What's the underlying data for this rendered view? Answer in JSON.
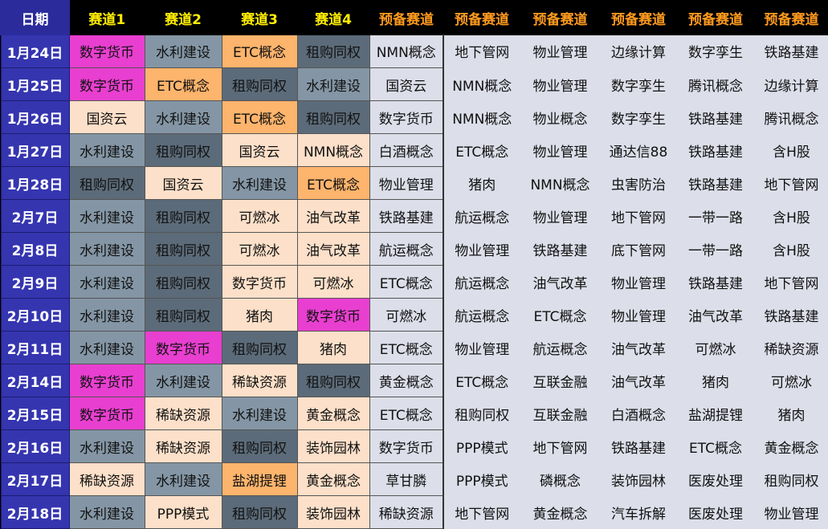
{
  "headers": [
    "日期",
    "赛道1",
    "赛道2",
    "赛道3",
    "赛道4",
    "预备赛道",
    "预备赛道",
    "预备赛道",
    "预备赛道",
    "预备赛道",
    "预备赛道"
  ],
  "colors": {
    "magenta": "#e83fd0",
    "steel": "#8496a5",
    "orange": "#fdb46c",
    "dark": "#5c6b79",
    "peach": "#fde0c9",
    "light": "#dcdee9"
  },
  "rows": [
    {
      "date": "1月24日",
      "lanes": [
        [
          "数字货币",
          "magenta"
        ],
        [
          "水利建设",
          "steel"
        ],
        [
          "ETC概念",
          "orange"
        ],
        [
          "租购同权",
          "dark"
        ],
        [
          "NMN概念",
          "light"
        ]
      ],
      "reserve": [
        "地下管网",
        "物业管理",
        "边缘计算",
        "数字孪生",
        "铁路基建"
      ]
    },
    {
      "date": "1月25日",
      "lanes": [
        [
          "数字货币",
          "magenta"
        ],
        [
          "ETC概念",
          "orange"
        ],
        [
          "租购同权",
          "dark"
        ],
        [
          "水利建设",
          "steel"
        ],
        [
          "国资云",
          "light"
        ]
      ],
      "reserve": [
        "NMN概念",
        "物业管理",
        "数字孪生",
        "腾讯概念",
        "边缘计算"
      ]
    },
    {
      "date": "1月26日",
      "lanes": [
        [
          "国资云",
          "peach"
        ],
        [
          "水利建设",
          "steel"
        ],
        [
          "ETC概念",
          "orange"
        ],
        [
          "租购同权",
          "dark"
        ],
        [
          "数字货币",
          "light"
        ]
      ],
      "reserve": [
        "NMN概念",
        "物业概念",
        "数字孪生",
        "铁路基建",
        "腾讯概念"
      ]
    },
    {
      "date": "1月27日",
      "lanes": [
        [
          "水利建设",
          "steel"
        ],
        [
          "租购同权",
          "dark"
        ],
        [
          "国资云",
          "peach"
        ],
        [
          "NMN概念",
          "peach"
        ],
        [
          "白酒概念",
          "light"
        ]
      ],
      "reserve": [
        "ETC概念",
        "物业管理",
        "通达信88",
        "铁路基建",
        "含H股"
      ]
    },
    {
      "date": "1月28日",
      "lanes": [
        [
          "租购同权",
          "dark"
        ],
        [
          "国资云",
          "peach"
        ],
        [
          "水利建设",
          "steel"
        ],
        [
          "ETC概念",
          "orange"
        ],
        [
          "物业管理",
          "light"
        ]
      ],
      "reserve": [
        "猪肉",
        "NMN概念",
        "虫害防治",
        "铁路基建",
        "地下管网"
      ]
    },
    {
      "date": "2月7日",
      "lanes": [
        [
          "水利建设",
          "steel"
        ],
        [
          "租购同权",
          "dark"
        ],
        [
          "可燃冰",
          "peach"
        ],
        [
          "油气改革",
          "peach"
        ],
        [
          "铁路基建",
          "light"
        ]
      ],
      "reserve": [
        "航运概念",
        "物业管理",
        "地下管网",
        "一带一路",
        "含H股"
      ]
    },
    {
      "date": "2月8日",
      "lanes": [
        [
          "水利建设",
          "steel"
        ],
        [
          "租购同权",
          "dark"
        ],
        [
          "可燃冰",
          "peach"
        ],
        [
          "油气改革",
          "peach"
        ],
        [
          "航运概念",
          "light"
        ]
      ],
      "reserve": [
        "物业管理",
        "铁路基建",
        "底下管网",
        "一带一路",
        "含H股"
      ]
    },
    {
      "date": "2月9日",
      "lanes": [
        [
          "水利建设",
          "steel"
        ],
        [
          "租购同权",
          "dark"
        ],
        [
          "数字货币",
          "peach"
        ],
        [
          "可燃冰",
          "peach"
        ],
        [
          "ETC概念",
          "light"
        ]
      ],
      "reserve": [
        "航运概念",
        "油气改革",
        "物业管理",
        "铁路基建",
        "地下管网"
      ]
    },
    {
      "date": "2月10日",
      "lanes": [
        [
          "水利建设",
          "steel"
        ],
        [
          "租购同权",
          "dark"
        ],
        [
          "猪肉",
          "peach"
        ],
        [
          "数字货币",
          "magenta"
        ],
        [
          "可燃冰",
          "light"
        ]
      ],
      "reserve": [
        "航运概念",
        "ETC概念",
        "物业管理",
        "油气改革",
        "铁路基建"
      ]
    },
    {
      "date": "2月11日",
      "lanes": [
        [
          "水利建设",
          "steel"
        ],
        [
          "数字货币",
          "magenta"
        ],
        [
          "租购同权",
          "dark"
        ],
        [
          "猪肉",
          "peach"
        ],
        [
          "ETC概念",
          "light"
        ]
      ],
      "reserve": [
        "物业管理",
        "航运概念",
        "油气改革",
        "可燃冰",
        "稀缺资源"
      ]
    },
    {
      "date": "2月14日",
      "lanes": [
        [
          "数字货币",
          "magenta"
        ],
        [
          "水利建设",
          "steel"
        ],
        [
          "稀缺资源",
          "peach"
        ],
        [
          "租购同权",
          "dark"
        ],
        [
          "黄金概念",
          "light"
        ]
      ],
      "reserve": [
        "ETC概念",
        "互联金融",
        "油气改革",
        "猪肉",
        "可燃冰"
      ]
    },
    {
      "date": "2月15日",
      "lanes": [
        [
          "数字货币",
          "magenta"
        ],
        [
          "稀缺资源",
          "peach"
        ],
        [
          "水利建设",
          "steel"
        ],
        [
          "黄金概念",
          "peach"
        ],
        [
          "ETC概念",
          "light"
        ]
      ],
      "reserve": [
        "租购同权",
        "互联金融",
        "白酒概念",
        "盐湖提锂",
        "猪肉"
      ]
    },
    {
      "date": "2月16日",
      "lanes": [
        [
          "水利建设",
          "steel"
        ],
        [
          "稀缺资源",
          "peach"
        ],
        [
          "租购同权",
          "dark"
        ],
        [
          "装饰园林",
          "peach"
        ],
        [
          "数字货币",
          "light"
        ]
      ],
      "reserve": [
        "PPP模式",
        "地下管网",
        "铁路基建",
        "ETC概念",
        "黄金概念"
      ]
    },
    {
      "date": "2月17日",
      "lanes": [
        [
          "稀缺资源",
          "peach"
        ],
        [
          "水利建设",
          "steel"
        ],
        [
          "盐湖提锂",
          "orange"
        ],
        [
          "黄金概念",
          "peach"
        ],
        [
          "草甘膦",
          "light"
        ]
      ],
      "reserve": [
        "PPP模式",
        "磷概念",
        "装饰园林",
        "医废处理",
        "租购同权"
      ]
    },
    {
      "date": "2月18日",
      "lanes": [
        [
          "水利建设",
          "steel"
        ],
        [
          "PPP模式",
          "peach"
        ],
        [
          "租购同权",
          "dark"
        ],
        [
          "装饰园林",
          "peach"
        ],
        [
          "稀缺资源",
          "light"
        ]
      ],
      "reserve": [
        "地下管网",
        "黄金概念",
        "汽车拆解",
        "医废处理",
        "物业管理"
      ]
    }
  ]
}
